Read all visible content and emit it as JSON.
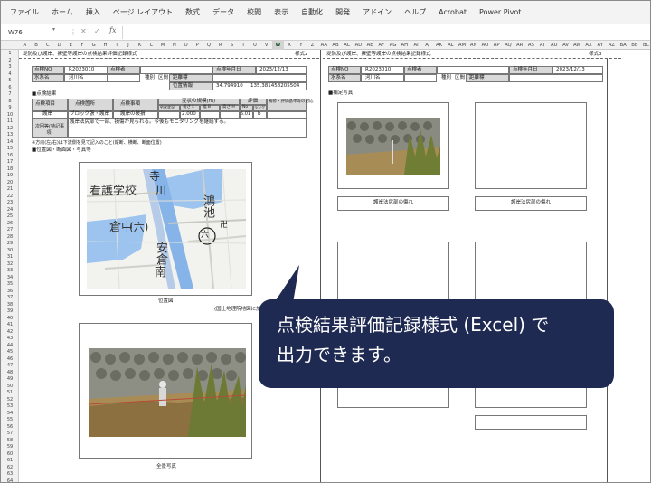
{
  "ribbon": {
    "tabs": [
      "ファイル",
      "ホーム",
      "挿入",
      "ページ レイアウト",
      "数式",
      "データ",
      "校閲",
      "表示",
      "自動化",
      "開発",
      "アドイン",
      "ヘルプ",
      "Acrobat",
      "Power Pivot"
    ]
  },
  "formula_bar": {
    "cell_ref": "W76",
    "dropdown": "▾",
    "separator": "⋮",
    "cancel": "✕",
    "enter": "✓",
    "fx": "fx",
    "value": ""
  },
  "columns": [
    "A",
    "B",
    "C",
    "D",
    "E",
    "F",
    "G",
    "H",
    "I",
    "J",
    "K",
    "L",
    "M",
    "N",
    "O",
    "P",
    "Q",
    "R",
    "S",
    "T",
    "U",
    "V",
    "W",
    "X",
    "Y",
    "Z",
    "AA",
    "AB",
    "AC",
    "AD",
    "AE",
    "AF",
    "AG",
    "AH",
    "AI",
    "AJ",
    "AK",
    "AL",
    "AM",
    "AN",
    "AO",
    "AP",
    "AQ",
    "AR",
    "AS",
    "AT",
    "AU",
    "AV",
    "AW",
    "AX",
    "AY",
    "AZ",
    "BA",
    "BB",
    "BC"
  ],
  "selected_column": "W",
  "rows": [
    "1",
    "2",
    "3",
    "4",
    "5",
    "6",
    "7",
    "8",
    "9",
    "10",
    "11",
    "12",
    "13",
    "14",
    "15",
    "16",
    "17",
    "18",
    "19",
    "20",
    "21",
    "22",
    "23",
    "24",
    "25",
    "26",
    "27",
    "28",
    "29",
    "30",
    "31",
    "32",
    "33",
    "34",
    "35",
    "36",
    "37",
    "38",
    "39",
    "40",
    "41",
    "42",
    "43",
    "44",
    "45",
    "46",
    "47",
    "48",
    "49",
    "50",
    "51",
    "52",
    "53",
    "54",
    "55",
    "56",
    "57",
    "58",
    "59",
    "60",
    "61",
    "62",
    "63",
    "64"
  ],
  "sheet_left": {
    "title": "堤防及び護岸、擁壁等護岸の点検結果評価記録様式",
    "form_no": "様式2",
    "row3": {
      "label1": "点検NO",
      "value1": "R2023010",
      "label2": "点検者",
      "label3": "点検年月日",
      "date": "2023/12/13"
    },
    "row4": {
      "label1": "水系名",
      "value1": "河川名",
      "label2": "種別",
      "label3": "区間",
      "label4": "距離標"
    },
    "row5": {
      "label1": "位置情報",
      "value1": "34.794910",
      "value2": "135.381458205504"
    },
    "section_result": "■点検結果",
    "headers": {
      "h1": "点検項目",
      "h2": "点検箇所",
      "h3": "点検事項",
      "h4": "変状の規模(m)",
      "h5": "評価",
      "h6": "補修・評価基準等の対応"
    },
    "subheaders": {
      "s1": "劣化状況",
      "s2": "長さ L",
      "s3": "幅 B",
      "s4": "高さ H",
      "s5": "No",
      "s6": "ランク"
    },
    "row9": {
      "c1": "護岸",
      "c2": "ブロック張・護岸",
      "c3": "護岸の破損",
      "c4": "2.000",
      "c5": "5.01",
      "c6": "b"
    },
    "row10": {
      "c1": "次回等(特記事項)",
      "c2": "護岸法尻部で一部、損傷が見られる。今後もモニタリングを継続する。"
    },
    "note": "※方向(左/右)は下流側を見て記入のこと(縦断、横断、断面位置)",
    "section_map": "■位置図・断面図・写真等",
    "map_caption": "位置図",
    "map_source": "(国土地理院地図に加筆)",
    "photo_caption": "全景写真",
    "map_labels": {
      "school": "看護学校",
      "temple": "寺",
      "river": "川",
      "pond": "鴻池",
      "six": "(六)",
      "kura": "倉中",
      "anakura": "安倉",
      "minami": "南",
      "swastika": "卍",
      "kanji_six": "六"
    }
  },
  "sheet_right": {
    "title": "堤防及び護岸、擁壁等護岸の点検結果記録様式",
    "form_no": "様式3",
    "row3": {
      "label1": "点検NO",
      "value1": "R2023010",
      "label2": "点検者",
      "label3": "点検年月日",
      "date": "2023/12/13"
    },
    "row4": {
      "label1": "水系名",
      "value1": "河川名",
      "label2": "種別",
      "label3": "区間",
      "label4": "距離標"
    },
    "section": "■補足写真",
    "cap1": "護岸法尻部の傷れ",
    "cap2": "護岸法尻部の傷れ"
  },
  "callout": {
    "line1": "点検結果評価記録様式 (Excel) で",
    "line2": "出力できます。",
    "bg": "#1f2a52",
    "fg": "#ffffff"
  }
}
